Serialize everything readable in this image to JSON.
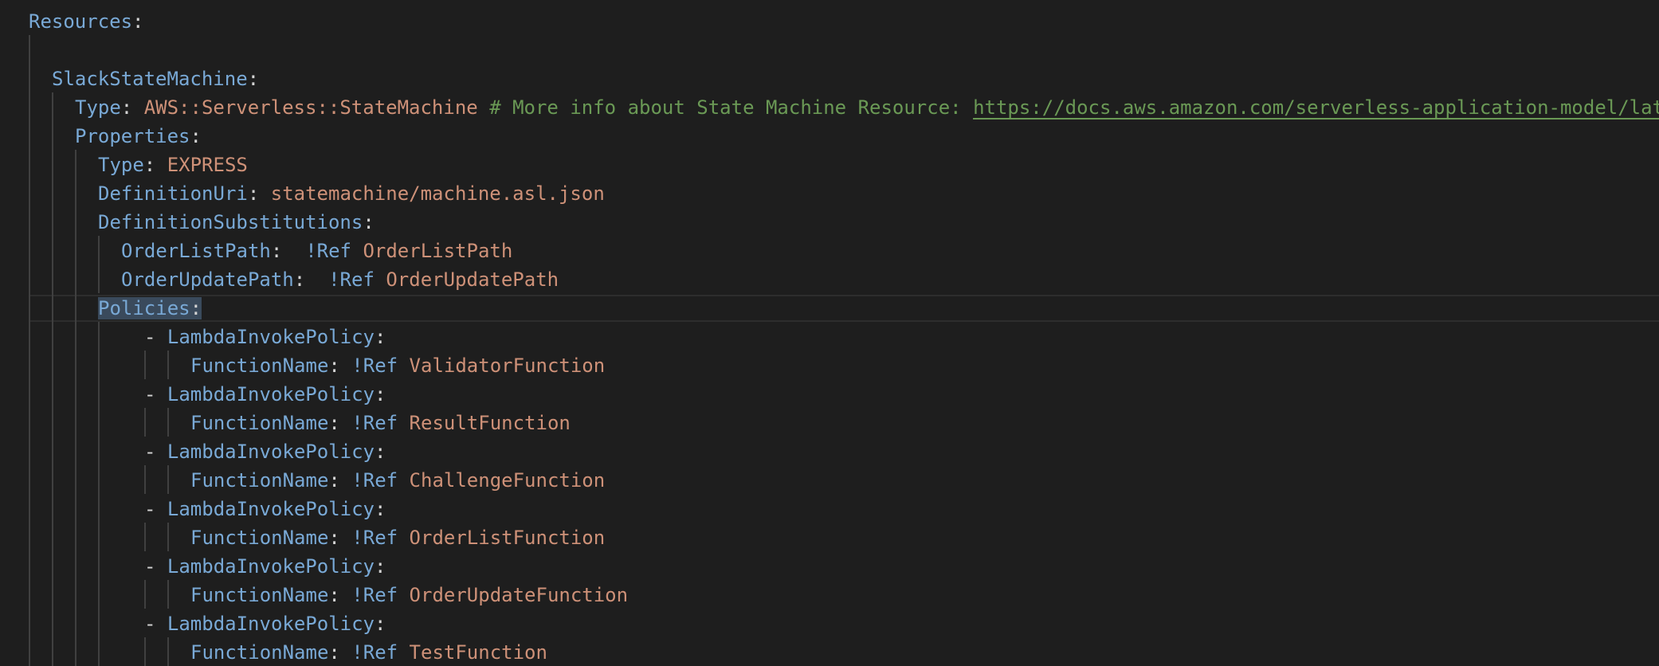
{
  "code": {
    "resources_key": "Resources",
    "state_machine_key": "SlackStateMachine",
    "type_key": "Type",
    "type_value": "AWS::Serverless::StateMachine",
    "type_comment": "# More info about State Machine Resource: ",
    "type_link": "https://docs.aws.amazon.com/serverless-application-model/lat",
    "properties_key": "Properties",
    "props_type_key": "Type",
    "props_type_value": "EXPRESS",
    "definition_uri_key": "DefinitionUri",
    "definition_uri_value": "statemachine/machine.asl.json",
    "definition_subs_key": "DefinitionSubstitutions",
    "order_list_path_key": "OrderListPath",
    "order_list_path_value": "OrderListPath",
    "order_update_path_key": "OrderUpdatePath",
    "order_update_path_value": "OrderUpdatePath",
    "policies_key": "Policies",
    "ref_tag": "!Ref",
    "dash": "-",
    "colon": ":",
    "policies": [
      {
        "policy": "LambdaInvokePolicy",
        "function_key": "FunctionName",
        "function_value": "ValidatorFunction"
      },
      {
        "policy": "LambdaInvokePolicy",
        "function_key": "FunctionName",
        "function_value": "ResultFunction"
      },
      {
        "policy": "LambdaInvokePolicy",
        "function_key": "FunctionName",
        "function_value": "ChallengeFunction"
      },
      {
        "policy": "LambdaInvokePolicy",
        "function_key": "FunctionName",
        "function_value": "OrderListFunction"
      },
      {
        "policy": "LambdaInvokePolicy",
        "function_key": "FunctionName",
        "function_value": "OrderUpdateFunction"
      },
      {
        "policy": "LambdaInvokePolicy",
        "function_key": "FunctionName",
        "function_value": "TestFunction"
      }
    ]
  }
}
